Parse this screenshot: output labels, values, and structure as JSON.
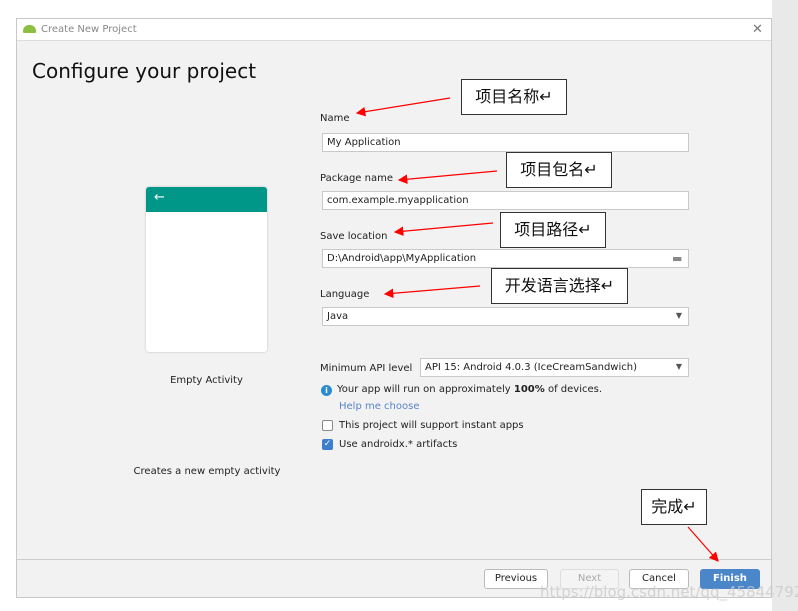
{
  "window": {
    "title": "Create New Project",
    "heading": "Configure your project"
  },
  "template": {
    "name": "Empty Activity",
    "description": "Creates a new empty activity",
    "back_icon": "arrow-left-icon",
    "accent": "#009688"
  },
  "form": {
    "name_label": "Name",
    "name_value": "My Application",
    "package_label": "Package name",
    "package_value": "com.example.myapplication",
    "location_label": "Save location",
    "location_value": "D:\\Android\\app\\MyApplication",
    "language_label": "Language",
    "language_value": "Java",
    "api_label": "Minimum API level",
    "api_value": "API 15: Android 4.0.3 (IceCreamSandwich)",
    "info_pre": "Your app will run on approximately ",
    "info_pct": "100%",
    "info_post": " of devices.",
    "help_link": "Help me choose",
    "instant_label": "This project will support instant apps",
    "instant_checked": false,
    "androidx_label": "Use androidx.* artifacts",
    "androidx_checked": true
  },
  "buttons": {
    "previous": "Previous",
    "next": "Next",
    "cancel": "Cancel",
    "finish": "Finish",
    "finish_color": "#4a86c8"
  },
  "annotations": {
    "name": "项目名称↵",
    "package": "项目包名↵",
    "location": "项目路径↵",
    "language": "开发语言选择↵",
    "finish": "完成↵",
    "arrow_color": "#ff0000"
  },
  "watermark": "https://blog.csdn.net/qq_45844792"
}
